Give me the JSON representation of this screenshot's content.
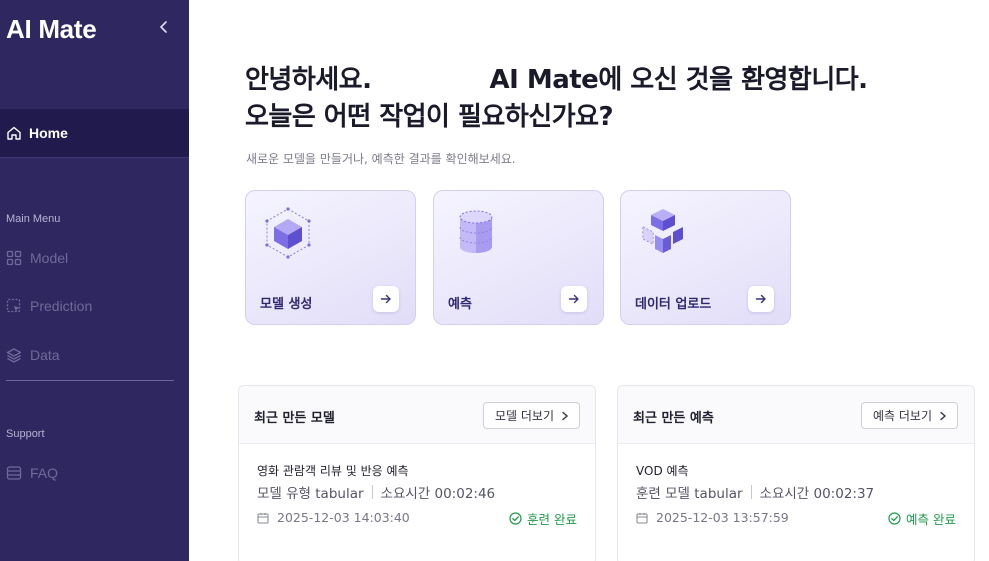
{
  "sidebar": {
    "brand": "AI Mate",
    "collapse_icon": "chevron-left-icon",
    "home_label": "Home",
    "section_main": "Main Menu",
    "items": [
      {
        "label": "Model",
        "icon": "grid-icon"
      },
      {
        "label": "Prediction",
        "icon": "prediction-icon"
      },
      {
        "label": "Data",
        "icon": "layers-icon"
      }
    ],
    "section_support": "Support",
    "faq_label": "FAQ"
  },
  "main": {
    "greeting_line1_left": "안녕하세요.",
    "greeting_line1_right": "AI Mate에 오신 것을 환영합니다.",
    "greeting_line2": "오늘은 어떤 작업이 필요하신가요?",
    "subtitle": "새로운 모델을 만들거나, 예측한 결과를 확인해보세요.",
    "cards": [
      {
        "label": "모델 생성",
        "icon": "cube-hexagon-icon"
      },
      {
        "label": "예측",
        "icon": "database-cylinder-icon"
      },
      {
        "label": "데이터 업로드",
        "icon": "split-cube-icon"
      }
    ]
  },
  "recent_models": {
    "title": "최근 만든 모델",
    "more_label": "모델 더보기",
    "item": {
      "name": "영화 관람객 리뷰 및 반응 예측",
      "type_label": "모델 유형 tabular",
      "duration": "소요시간 00:02:46",
      "date": "2025-12-03 14:03:40",
      "status": "훈련 완료"
    }
  },
  "recent_predictions": {
    "title": "최근 만든 예측",
    "more_label": "예측 더보기",
    "item": {
      "name": "VOD 예측",
      "type_label": "훈련 모델 tabular",
      "duration": "소요시간 00:02:37",
      "date": "2025-12-03 13:57:59",
      "status": "예측 완료"
    }
  },
  "colors": {
    "sidebar_bg": "#2f2760",
    "sidebar_active": "#211a4c",
    "accent": "#6c5ce7",
    "success": "#1e9a4a"
  }
}
